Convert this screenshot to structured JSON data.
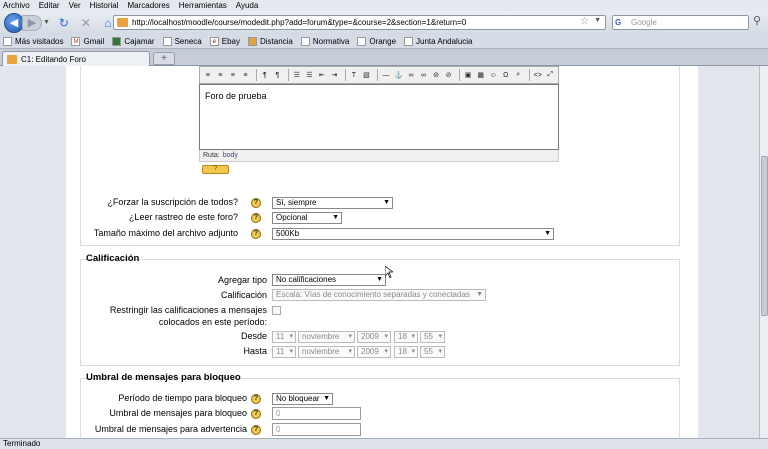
{
  "menu": [
    "Archivo",
    "Editar",
    "Ver",
    "Historial",
    "Marcadores",
    "Herramientas",
    "Ayuda"
  ],
  "nav": {
    "url": "http://localhost/moodle/course/modedit.php?add=forum&type=&course=2&section=1&return=0",
    "search_placeholder": "Google"
  },
  "bookmarks": [
    "Más visitados",
    "Gmail",
    "Cajamar",
    "Seneca",
    "Ebay",
    "Distancia",
    "Normativa",
    "Orange",
    "Junta Andalucia"
  ],
  "tab": {
    "title": "C1: Editando Foro"
  },
  "editor": {
    "text": "Foro de prueba",
    "path_label": "Ruta:",
    "path_value": "body",
    "help_label": "?"
  },
  "general": {
    "force_label": "¿Forzar la suscripción de todos?",
    "force_value": "Sí, siempre",
    "track_label": "¿Leer rastreo de este foro?",
    "track_value": "Opcional",
    "maxsize_label": "Tamaño máximo del archivo adjunto",
    "maxsize_value": "500Kb"
  },
  "grading": {
    "legend": "Calificación",
    "type_label": "Agregar tipo",
    "type_value": "No calificaciones",
    "scale_label": "Calificación",
    "scale_value": "Escala: Vías de conocimiento separadas y conectadas",
    "restrict_label1": "Restringir las calificaciones a mensajes",
    "restrict_label2": "colocados en este período:",
    "from_label": "Desde",
    "to_label": "Hasta",
    "from": {
      "day": "11",
      "month": "noviembre",
      "year": "2009",
      "hour": "18",
      "min": "55"
    },
    "to": {
      "day": "11",
      "month": "noviembre",
      "year": "2009",
      "hour": "18",
      "min": "55"
    }
  },
  "blocking": {
    "legend": "Umbral de mensajes para bloqueo",
    "period_label": "Período de tiempo para bloqueo",
    "period_value": "No bloquear",
    "threshold_label": "Umbral de mensajes para bloqueo",
    "threshold_value": "0",
    "warning_label": "Umbral de mensajes para advertencia",
    "warning_value": "0"
  },
  "status": "Terminado"
}
